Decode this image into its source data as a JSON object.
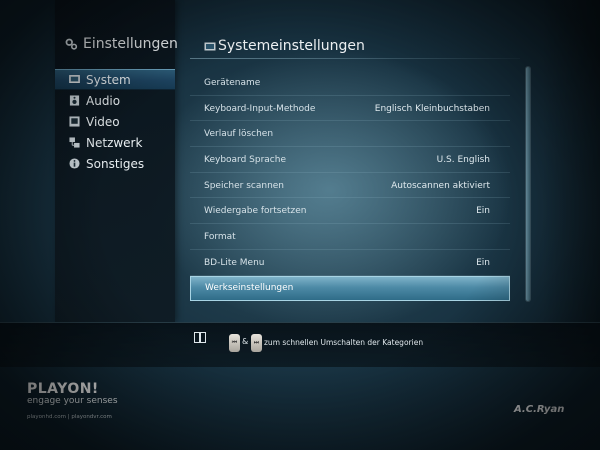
{
  "sidebar": {
    "title": "Einstellungen",
    "items": [
      {
        "label": "System",
        "icon": "monitor-icon",
        "active": true
      },
      {
        "label": "Audio",
        "icon": "speaker-icon",
        "active": false
      },
      {
        "label": "Video",
        "icon": "video-icon",
        "active": false
      },
      {
        "label": "Netzwerk",
        "icon": "network-icon",
        "active": false
      },
      {
        "label": "Sonstiges",
        "icon": "info-icon",
        "active": false
      }
    ]
  },
  "main": {
    "title": "Systemeinstellungen",
    "settings": [
      {
        "label": "Gerätename",
        "value": ""
      },
      {
        "label": "Keyboard-Input-Methode",
        "value": "Englisch Kleinbuchstaben"
      },
      {
        "label": "Verlauf löschen",
        "value": ""
      },
      {
        "label": "Keyboard Sprache",
        "value": "U.S. English"
      },
      {
        "label": "Speicher scannen",
        "value": "Autoscannen aktiviert"
      },
      {
        "label": "Wiedergabe fortsetzen",
        "value": "Ein"
      },
      {
        "label": "Format",
        "value": ""
      },
      {
        "label": "BD-Lite Menu",
        "value": "Ein"
      },
      {
        "label": "Werkseinstellungen",
        "value": "",
        "selected": true
      }
    ]
  },
  "hint": {
    "amp": "&",
    "text": "zum schnellen Umschalten der Kategorien",
    "key_prev": "⏮",
    "key_next": "⏭"
  },
  "branding": {
    "logo": "PLAYON!",
    "tagline": "engage your senses",
    "urls": "playonhd.com | playondvr.com",
    "maker": "A.C.Ryan"
  },
  "colors": {
    "accent": "#4d8aa6",
    "active_item": "#1d4360"
  }
}
